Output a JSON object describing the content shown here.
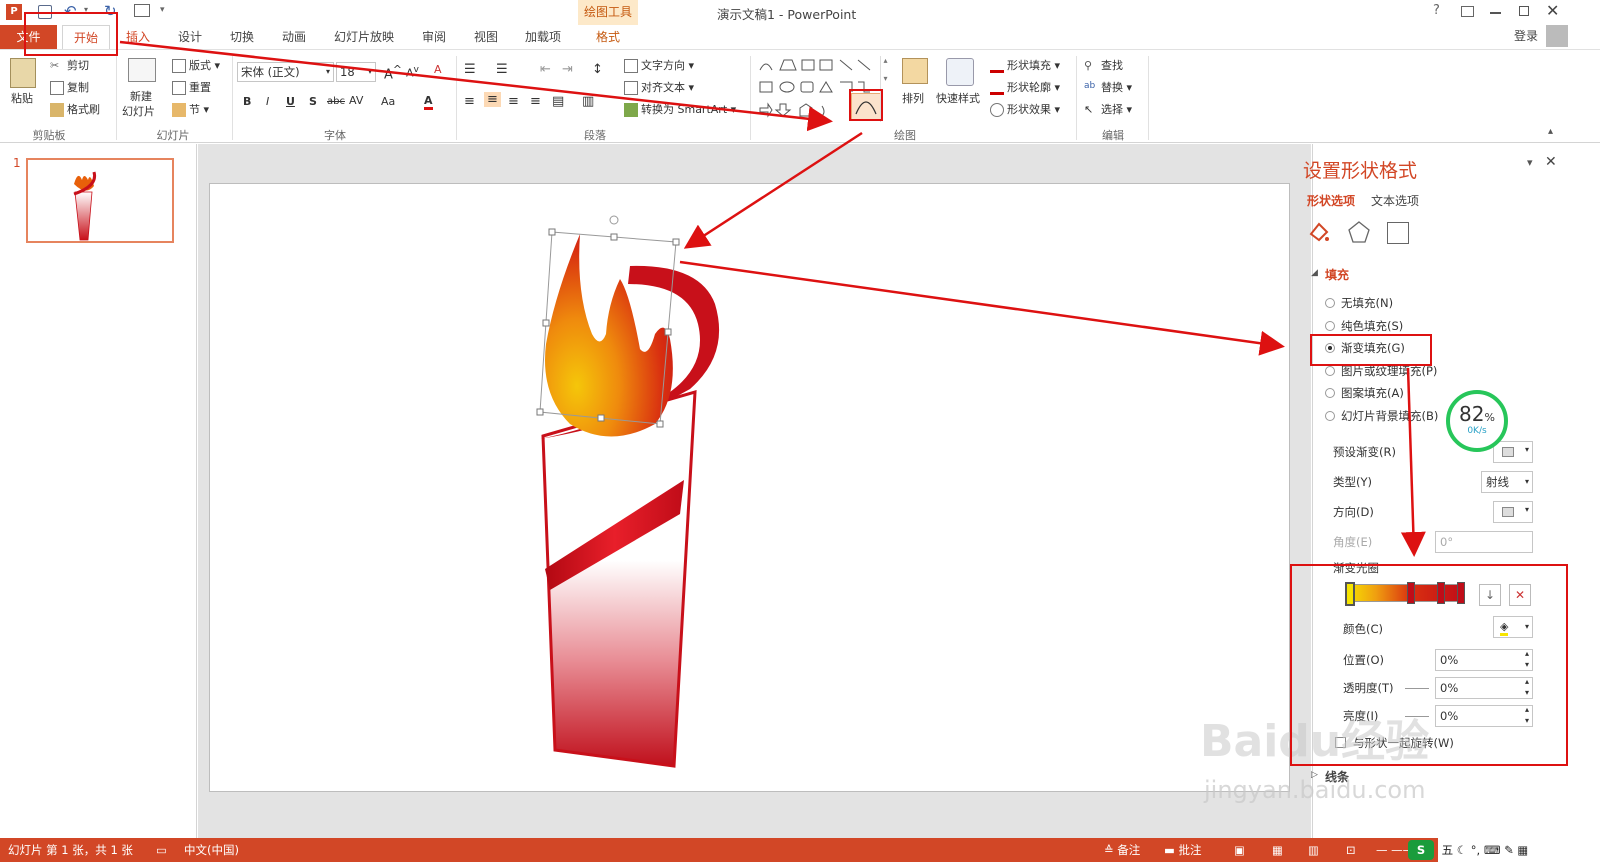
{
  "window": {
    "title": "演示文稿1 - PowerPoint",
    "context_tab_group": "绘图工具",
    "help": "?",
    "login": "登录"
  },
  "tabs": [
    "文件",
    "开始",
    "插入",
    "设计",
    "切换",
    "动画",
    "幻灯片放映",
    "审阅",
    "视图",
    "加载项",
    "格式"
  ],
  "ribbon": {
    "clipboard": {
      "paste": "粘贴",
      "cut": "剪切",
      "copy": "复制",
      "format_painter": "格式刷",
      "group": "剪贴板"
    },
    "slides": {
      "new_slide": "新建",
      "new_slide2": "幻灯片",
      "layout": "版式",
      "reset": "重置",
      "section": "节",
      "group": "幻灯片"
    },
    "font": {
      "font_name": "宋体 (正文)",
      "font_size": "18",
      "group": "字体",
      "bold": "B",
      "italic": "I",
      "underline": "U",
      "shadow": "S",
      "strike": "abc",
      "spacing": "AV",
      "case": "Aa",
      "color": "A"
    },
    "paragraph": {
      "text_direction": "文字方向",
      "align_text": "对齐文本",
      "convert_smartart": "转换为 SmartArt",
      "group": "段落"
    },
    "drawing": {
      "arrange": "排列",
      "quick_styles": "快速样式",
      "shape_fill": "形状填充",
      "shape_outline": "形状轮廓",
      "shape_effects": "形状效果",
      "group": "绘图"
    },
    "editing": {
      "find": "查找",
      "replace": "替换",
      "select": "选择",
      "group": "编辑"
    }
  },
  "thumbs": {
    "slide_number": "1"
  },
  "pane": {
    "title": "设置形状格式",
    "tab_shape": "形状选项",
    "tab_text": "文本选项",
    "fill_section": "填充",
    "fill_options": [
      "无填充(N)",
      "纯色填充(S)",
      "渐变填充(G)",
      "图片或纹理填充(P)",
      "图案填充(A)",
      "幻灯片背景填充(B)"
    ],
    "selected_fill": 2,
    "preset_gradient": "预设渐变(R)",
    "type_label": "类型(Y)",
    "type_value": "射线",
    "direction_label": "方向(D)",
    "angle_label": "角度(E)",
    "angle_value": "0°",
    "stops_label": "渐变光圈",
    "color_label": "颜色(C)",
    "position_label": "位置(O)",
    "position_value": "0%",
    "transparency_label": "透明度(T)",
    "transparency_value": "0%",
    "brightness_label": "亮度(I)",
    "brightness_value": "0%",
    "rotate_with_shape": "与形状一起旋转(W)",
    "line_section": "线条"
  },
  "speed_widget": {
    "percent": "82",
    "unit": "%",
    "rate": "0K/s"
  },
  "statusbar": {
    "slide_info": "幻灯片 第 1 张，共 1 张",
    "language": "中文(中国)",
    "notes": "备注",
    "comments": "批注"
  },
  "watermark": {
    "brand": "Baidu经验",
    "url": "jingyan.baidu.com"
  },
  "colors": {
    "accent": "#d24726",
    "annotation_red": "#dd1111",
    "torch_red": "#c8101a"
  }
}
